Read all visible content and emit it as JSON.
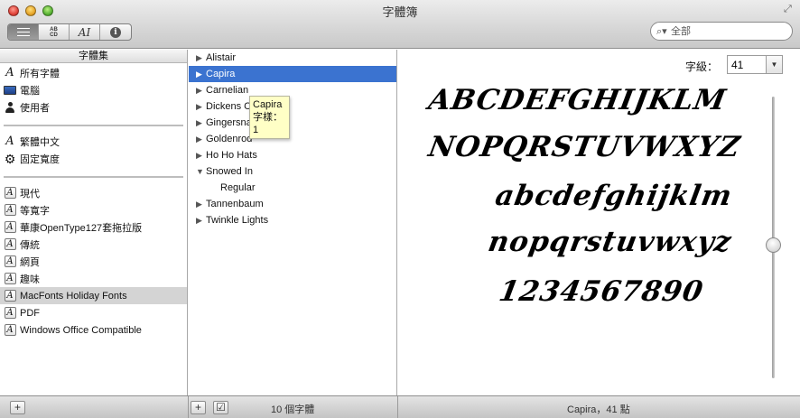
{
  "window": {
    "title": "字體簿"
  },
  "toolbar": {
    "view_modes": [
      {
        "name": "list-view",
        "label": ""
      },
      {
        "name": "sample-view",
        "label": "AB CD"
      },
      {
        "name": "custom-view",
        "label": "AI"
      },
      {
        "name": "info-view",
        "label": "i"
      }
    ],
    "search": {
      "placeholder": "全部",
      "value": ""
    }
  },
  "collections": {
    "header": "字體集",
    "items": [
      {
        "label": "所有字體",
        "icon": "font-icon"
      },
      {
        "label": "電腦",
        "icon": "computer-icon"
      },
      {
        "label": "使用者",
        "icon": "user-icon"
      },
      {
        "label": "繁體中文",
        "icon": "font-icon"
      },
      {
        "label": "固定寬度",
        "icon": "gear-icon"
      },
      {
        "label": "現代",
        "icon": "collection-icon"
      },
      {
        "label": "等寬字",
        "icon": "collection-icon"
      },
      {
        "label": "華康OpenType127套拖拉版",
        "icon": "collection-icon"
      },
      {
        "label": "傳統",
        "icon": "collection-icon"
      },
      {
        "label": "網頁",
        "icon": "collection-icon"
      },
      {
        "label": "趣味",
        "icon": "collection-icon"
      },
      {
        "label": "MacFonts Holiday Fonts",
        "icon": "collection-icon",
        "selected": true
      },
      {
        "label": "PDF",
        "icon": "collection-icon"
      },
      {
        "label": "Windows Office Compatible",
        "icon": "collection-icon"
      }
    ]
  },
  "fonts": {
    "items": [
      {
        "label": "Alistair"
      },
      {
        "label": "Capira",
        "selected": true
      },
      {
        "label": "Carnelian"
      },
      {
        "label": "Dickens C"
      },
      {
        "label": "Gingersna"
      },
      {
        "label": "Goldenrod"
      },
      {
        "label": "Ho Ho Hats"
      },
      {
        "label": "Snowed In",
        "expanded": true
      },
      {
        "label": "Regular",
        "sub": true
      },
      {
        "label": "Tannenbaum"
      },
      {
        "label": "Twinkle Lights"
      }
    ],
    "tooltip": {
      "name": "Capira",
      "styles": "字樣：1"
    }
  },
  "preview": {
    "size_label": "字級：",
    "size_value": "41",
    "lines": [
      "ABCDEFGHIJKLM",
      "NOPQRSTUVWXYZ",
      "abcdefghijklm",
      "nopqrstuvwxyz",
      "1234567890"
    ],
    "slider_fraction": 0.53
  },
  "status": {
    "font_count": "10 個字體",
    "selection": "Capira，41 點"
  }
}
